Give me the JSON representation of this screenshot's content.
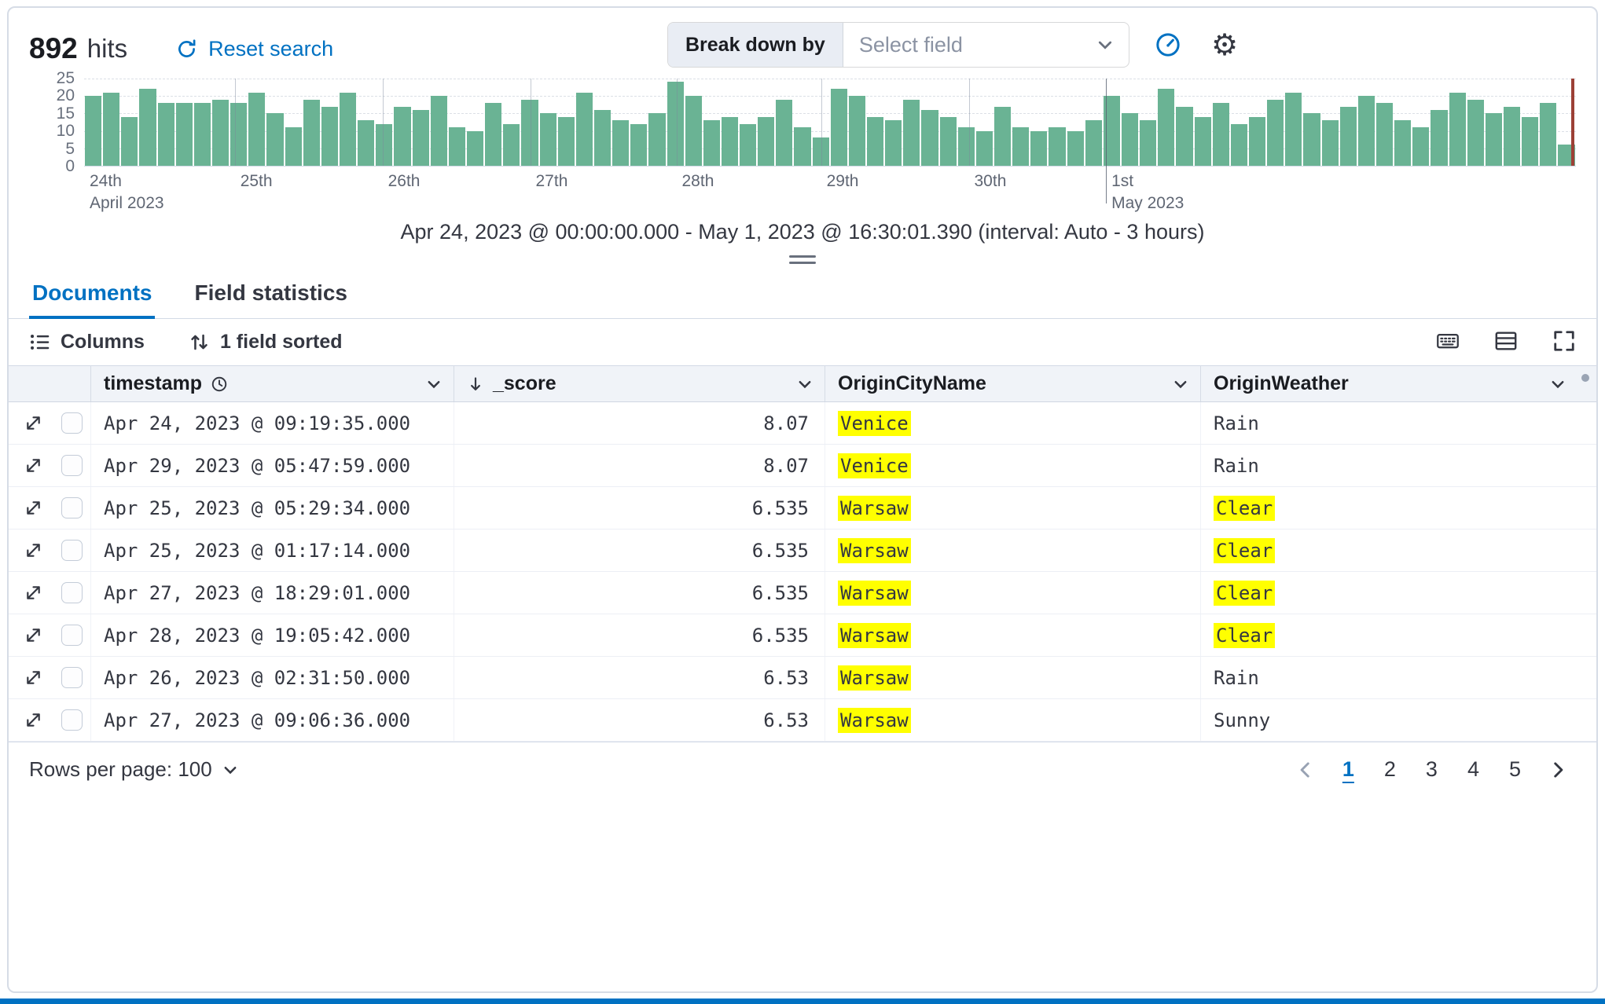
{
  "header": {
    "hits_count": "892",
    "hits_label": "hits",
    "reset_search": "Reset search",
    "breakdown_label": "Break down by",
    "breakdown_placeholder": "Select field"
  },
  "icons": {
    "gear_glyph": "⚙",
    "names": [
      "refresh-icon",
      "chevron-down-icon",
      "gauge-icon",
      "gear-icon",
      "clock-icon",
      "sort-descending-icon",
      "columns-list-icon",
      "field-sort-icon",
      "keyboard-icon",
      "display-density-icon",
      "fullscreen-icon",
      "expand-row-icon",
      "chevron-left-icon",
      "chevron-right-icon"
    ]
  },
  "chart_data": {
    "type": "bar",
    "title": "Document count over time",
    "xlabel": "",
    "ylabel": "",
    "ylim": [
      0,
      25
    ],
    "y_ticks": [
      25,
      20,
      15,
      10,
      5,
      0
    ],
    "bar_color": "#6ab394",
    "end_marker_pos": 99.7,
    "interval_caption": "Apr 24, 2023 @ 00:00:00.000 - May 1, 2023 @ 16:30:01.390 (interval: Auto - 3 hours)",
    "x_labels": [
      {
        "pos": 0,
        "line1": "24th",
        "line2": "April 2023",
        "major": false
      },
      {
        "pos": 10.1,
        "line1": "25th",
        "line2": "",
        "major": false
      },
      {
        "pos": 20.0,
        "line1": "26th",
        "line2": "",
        "major": false
      },
      {
        "pos": 29.9,
        "line1": "27th",
        "line2": "",
        "major": false
      },
      {
        "pos": 39.7,
        "line1": "28th",
        "line2": "",
        "major": false
      },
      {
        "pos": 49.4,
        "line1": "29th",
        "line2": "",
        "major": false
      },
      {
        "pos": 59.3,
        "line1": "30th",
        "line2": "",
        "major": false
      },
      {
        "pos": 68.5,
        "line1": "1st",
        "line2": "May 2023",
        "major": true
      }
    ],
    "values": [
      20,
      21,
      14,
      22,
      18,
      18,
      18,
      19,
      18,
      21,
      15,
      11,
      19,
      17,
      21,
      13,
      12,
      17,
      16,
      20,
      11,
      10,
      18,
      12,
      19,
      15,
      14,
      21,
      16,
      13,
      12,
      15,
      24,
      20,
      13,
      14,
      12,
      14,
      19,
      11,
      8,
      22,
      20,
      14,
      13,
      19,
      16,
      14,
      11,
      10,
      17,
      11,
      10,
      11,
      10,
      13,
      20,
      15,
      13,
      22,
      17,
      14,
      18,
      12,
      14,
      19,
      21,
      15,
      13,
      17,
      20,
      18,
      13,
      11,
      16,
      21,
      19,
      15,
      17,
      14,
      18,
      6
    ]
  },
  "tabs": [
    {
      "label": "Documents",
      "active": true
    },
    {
      "label": "Field statistics",
      "active": false
    }
  ],
  "toolbar": {
    "columns_label": "Columns",
    "sorted_label": "1 field sorted"
  },
  "table": {
    "columns": [
      "timestamp",
      "_score",
      "OriginCityName",
      "OriginWeather"
    ],
    "rows": [
      {
        "timestamp": "Apr 24, 2023 @ 09:19:35.000",
        "score": "8.07",
        "city": "Venice",
        "city_highlight": true,
        "weather": "Rain",
        "weather_highlight": false
      },
      {
        "timestamp": "Apr 29, 2023 @ 05:47:59.000",
        "score": "8.07",
        "city": "Venice",
        "city_highlight": true,
        "weather": "Rain",
        "weather_highlight": false
      },
      {
        "timestamp": "Apr 25, 2023 @ 05:29:34.000",
        "score": "6.535",
        "city": "Warsaw",
        "city_highlight": true,
        "weather": "Clear",
        "weather_highlight": true
      },
      {
        "timestamp": "Apr 25, 2023 @ 01:17:14.000",
        "score": "6.535",
        "city": "Warsaw",
        "city_highlight": true,
        "weather": "Clear",
        "weather_highlight": true
      },
      {
        "timestamp": "Apr 27, 2023 @ 18:29:01.000",
        "score": "6.535",
        "city": "Warsaw",
        "city_highlight": true,
        "weather": "Clear",
        "weather_highlight": true
      },
      {
        "timestamp": "Apr 28, 2023 @ 19:05:42.000",
        "score": "6.535",
        "city": "Warsaw",
        "city_highlight": true,
        "weather": "Clear",
        "weather_highlight": true
      },
      {
        "timestamp": "Apr 26, 2023 @ 02:31:50.000",
        "score": "6.53",
        "city": "Warsaw",
        "city_highlight": true,
        "weather": "Rain",
        "weather_highlight": false
      },
      {
        "timestamp": "Apr 27, 2023 @ 09:06:36.000",
        "score": "6.53",
        "city": "Warsaw",
        "city_highlight": true,
        "weather": "Sunny",
        "weather_highlight": false
      }
    ]
  },
  "footer": {
    "rows_per_page_label": "Rows per page: 100",
    "pages": [
      "1",
      "2",
      "3",
      "4",
      "5"
    ],
    "active_page": "1"
  },
  "colors": {
    "accent_blue": "#0071c2",
    "highlight_yellow": "#ffff00",
    "bar_green": "#6ab394",
    "end_marker_red": "#9c4036"
  }
}
